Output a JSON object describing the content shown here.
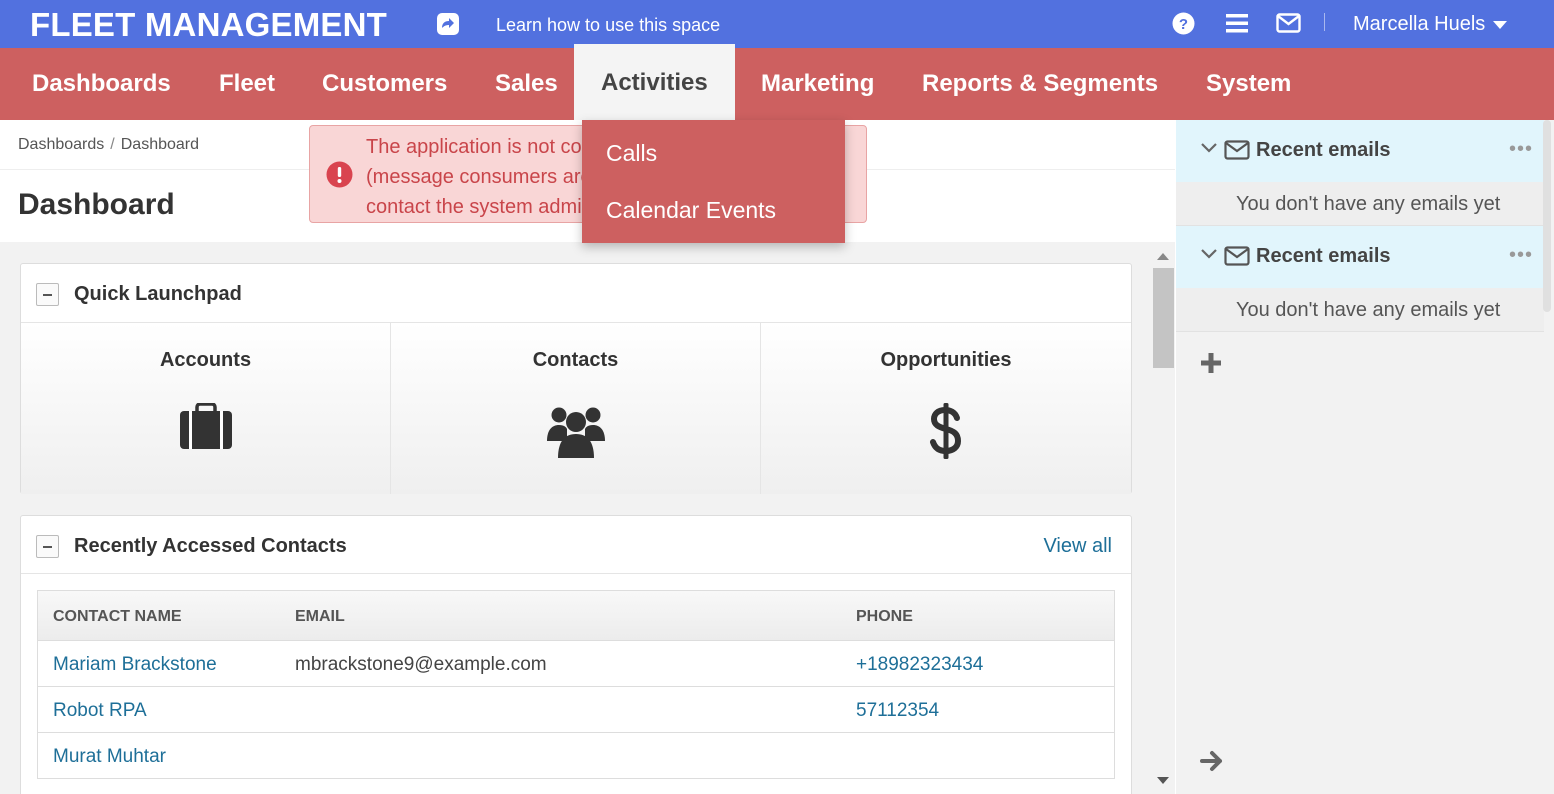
{
  "app": {
    "title": "FLEET MANAGEMENT",
    "learn_link": "Learn how to use this space",
    "user_name": "Marcella Huels"
  },
  "nav": {
    "items": [
      {
        "label": "Dashboards"
      },
      {
        "label": "Fleet"
      },
      {
        "label": "Customers"
      },
      {
        "label": "Sales"
      },
      {
        "label": "Activities",
        "active": true
      },
      {
        "label": "Marketing"
      },
      {
        "label": "Reports & Segments"
      },
      {
        "label": "System"
      }
    ],
    "dropdown": [
      "Calls",
      "Calendar Events"
    ]
  },
  "breadcrumb": [
    "Dashboards",
    "Dashboard"
  ],
  "page_title": "Dashboard",
  "alert": {
    "lines": [
      "The application is not con",
      "(message consumers are",
      "contact the system admin"
    ]
  },
  "quick_launchpad": {
    "title": "Quick Launchpad",
    "items": [
      {
        "label": "Accounts",
        "icon": "briefcase-icon"
      },
      {
        "label": "Contacts",
        "icon": "users-icon"
      },
      {
        "label": "Opportunities",
        "icon": "dollar-icon"
      }
    ]
  },
  "recent_contacts": {
    "title": "Recently Accessed Contacts",
    "view_all": "View all",
    "columns": [
      "CONTACT NAME",
      "EMAIL",
      "PHONE"
    ],
    "rows": [
      {
        "name": "Mariam Brackstone",
        "email": "mbrackstone9@example.com",
        "phone": "+18982323434"
      },
      {
        "name": "Robot RPA",
        "email": "",
        "phone": "57112354"
      },
      {
        "name": "Murat Muhtar",
        "email": "",
        "phone": ""
      }
    ]
  },
  "sidebar": {
    "widgets": [
      {
        "title": "Recent emails",
        "more": "•••",
        "empty": "You don't have any emails yet"
      },
      {
        "title": "Recent emails",
        "more": "•••",
        "empty": "You don't have any emails yet"
      }
    ]
  },
  "colors": {
    "topbar": "#5271df",
    "nav": "#cd6060",
    "link": "#1e6f98",
    "alert_bg": "#f9d6d6",
    "alert_text": "#c9454a"
  }
}
